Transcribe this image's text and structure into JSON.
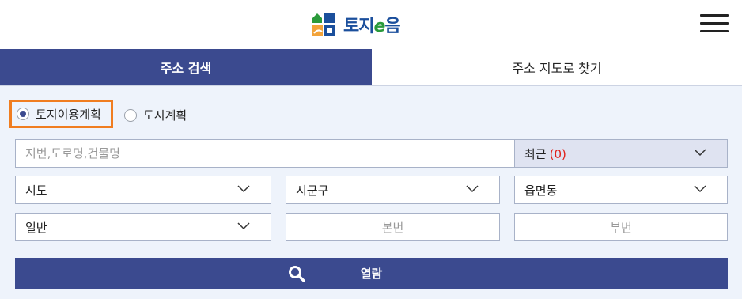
{
  "header": {
    "logo_text_prefix": "토지",
    "logo_text_e": "e",
    "logo_text_suffix": "음"
  },
  "tabs": [
    {
      "label": "주소 검색",
      "active": true
    },
    {
      "label": "주소 지도로 찾기",
      "active": false
    }
  ],
  "radio": [
    {
      "label": "토지이용계획",
      "checked": true
    },
    {
      "label": "도시계획",
      "checked": false
    }
  ],
  "search": {
    "placeholder": "지번,도로명,건물명",
    "value": ""
  },
  "recent": {
    "label": "최근",
    "count": "(0)"
  },
  "selects": {
    "sido": "시도",
    "sigungu": "시군구",
    "eupmyeondong": "읍면동",
    "general": "일반"
  },
  "lot": {
    "main_placeholder": "본번",
    "sub_placeholder": "부번"
  },
  "view_button": {
    "label": "열람"
  },
  "colors": {
    "accent": "#3b4a8f",
    "highlight_border": "#f07d20",
    "count_red": "#e0201a",
    "background": "#eef3fb"
  },
  "icons": [
    "logo-mark-icon",
    "hamburger-menu-icon",
    "chevron-down-icon",
    "search-icon"
  ]
}
